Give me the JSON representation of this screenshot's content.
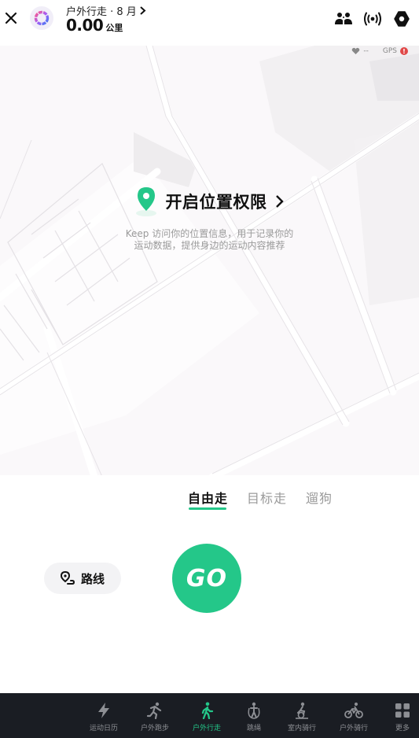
{
  "header": {
    "title": "户外行走 · 8 月",
    "distance_value": "0.00",
    "distance_unit": "公里",
    "icons": [
      "close-icon",
      "keep-logo-icon",
      "group-icon",
      "signal-icon",
      "settings-icon"
    ]
  },
  "map": {
    "status_heart": "--",
    "status_gps": "GPS",
    "permission_title": "开启位置权限",
    "permission_desc_line1": "Keep 访问你的位置信息，用于记录你的",
    "permission_desc_line2": "运动数据，提供身边的运动内容推荐"
  },
  "panel": {
    "tabs": [
      {
        "label": "自由走",
        "active": true
      },
      {
        "label": "目标走",
        "active": false
      },
      {
        "label": "遛狗",
        "active": false
      }
    ],
    "route_label": "路线",
    "go_label": "GO"
  },
  "colors": {
    "accent": "#24c789",
    "nav_bg": "#1a1d23",
    "gps_alert": "#e04848"
  },
  "bottom_nav": [
    {
      "label": "运动日历",
      "icon": "lightning-icon"
    },
    {
      "label": "户外跑步",
      "icon": "run-icon"
    },
    {
      "label": "户外行走",
      "icon": "walk-icon",
      "active": true
    },
    {
      "label": "跳绳",
      "icon": "jump-rope-icon"
    },
    {
      "label": "室内骑行",
      "icon": "indoor-bike-icon"
    },
    {
      "label": "户外骑行",
      "icon": "bike-icon"
    },
    {
      "label": "更多",
      "icon": "grid-icon"
    }
  ]
}
